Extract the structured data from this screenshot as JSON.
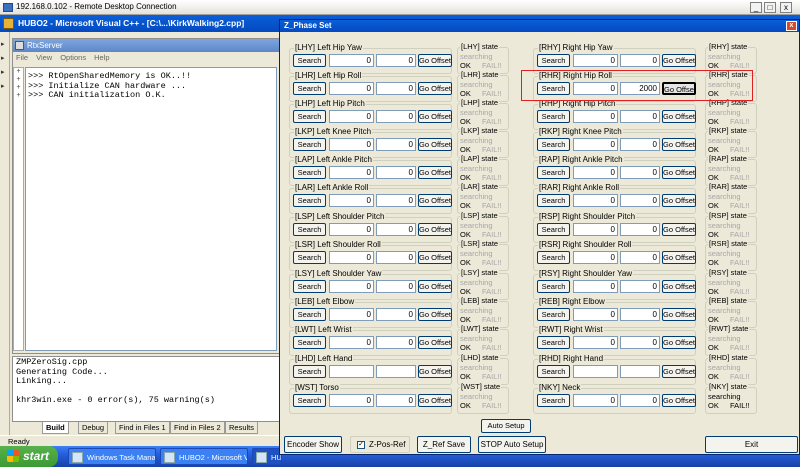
{
  "rdc": {
    "title": "192.168.0.102 - Remote Desktop Connection",
    "min": "_",
    "max": "□",
    "close": "x"
  },
  "vc": {
    "title": "HUBO2 - Microsoft Visual C++ - [C:\\...\\KirkWalking2.cpp]"
  },
  "rtx": {
    "title": "RtxServer",
    "menu": [
      "File",
      "View",
      "Options",
      "Help"
    ],
    "console": ">>> RtOpenSharedMemory is OK..!!\n>>> Initialize CAN hardware ...\n>>> CAN initialization O.K."
  },
  "output": {
    "text": "ZMPZeroSig.cpp\nGenerating Code...\nLinking...\n\nkhr3win.exe - 0 error(s), 75 warning(s)",
    "tabs": [
      "Build",
      "Debug",
      "Find in Files 1",
      "Find in Files 2",
      "Results"
    ]
  },
  "status": "Ready",
  "taskbar": {
    "start": "start",
    "items": [
      "Windows Task Manager",
      "HUBO2 - Microsoft Vis...",
      "HU"
    ]
  },
  "dialog": {
    "title": "Z_Phase Set",
    "close": "x",
    "common": {
      "search": "Search",
      "go_offset": "Go Offset",
      "go_offset_active": "Go Offset",
      "searching": "searching",
      "ok": "OK",
      "fail": "FAIL!!",
      "state": "state"
    },
    "left_joints": [
      {
        "label": "[LHY] Left Hip Yaw",
        "v1": "0",
        "v2": "0",
        "state": "[LHY] state"
      },
      {
        "label": "[LHR] Left Hip Roll",
        "v1": "0",
        "v2": "0",
        "state": "[LHR] state"
      },
      {
        "label": "[LHP] Left Hip Pitch",
        "v1": "0",
        "v2": "0",
        "state": "[LHP] state"
      },
      {
        "label": "[LKP] Left Knee Pitch",
        "v1": "0",
        "v2": "0",
        "state": "[LKP] state"
      },
      {
        "label": "[LAP] Left Ankle Pitch",
        "v1": "0",
        "v2": "0",
        "state": "[LAP] state"
      },
      {
        "label": "[LAR] Left Ankle Roll",
        "v1": "0",
        "v2": "0",
        "state": "[LAR] state"
      },
      {
        "label": "[LSP] Left Shoulder Pitch",
        "v1": "0",
        "v2": "0",
        "state": "[LSP] state"
      },
      {
        "label": "[LSR] Left Shoulder Roll",
        "v1": "0",
        "v2": "0",
        "state": "[LSR] state"
      },
      {
        "label": "[LSY] Left Shoulder Yaw",
        "v1": "0",
        "v2": "0",
        "state": "[LSY] state"
      },
      {
        "label": "[LEB] Left Elbow",
        "v1": "0",
        "v2": "0",
        "state": "[LEB] state"
      },
      {
        "label": "[LWT] Left Wrist",
        "v1": "0",
        "v2": "0",
        "state": "[LWT] state"
      },
      {
        "label": "[LHD] Left Hand",
        "v1": "",
        "v2": "",
        "state": "[LHD] state"
      },
      {
        "label": "[WST] Torso",
        "v1": "0",
        "v2": "0",
        "state": "[WST] state"
      }
    ],
    "right_joints": [
      {
        "label": "[RHY] Right Hip Yaw",
        "v1": "0",
        "v2": "0",
        "state": "[RHY] state"
      },
      {
        "label": "[RHR] Right Hip Roll",
        "v1": "0",
        "v2": "2000",
        "state": "[RHR] state"
      },
      {
        "label": "[RHP] Right Hip Pitch",
        "v1": "0",
        "v2": "0",
        "state": "[RHP] state"
      },
      {
        "label": "[RKP] Right Knee Pitch",
        "v1": "0",
        "v2": "0",
        "state": "[RKP] state"
      },
      {
        "label": "[RAP] Right Ankle Pitch",
        "v1": "0",
        "v2": "0",
        "state": "[RAP] state"
      },
      {
        "label": "[RAR] Right Ankle Roll",
        "v1": "0",
        "v2": "0",
        "state": "[RAR] state"
      },
      {
        "label": "[RSP] Right Shoulder Pitch",
        "v1": "0",
        "v2": "0",
        "state": "[RSP] state"
      },
      {
        "label": "[RSR] Right Shoulder Roll",
        "v1": "0",
        "v2": "0",
        "state": "[RSR] state"
      },
      {
        "label": "[RSY] Right Shoulder Yaw",
        "v1": "0",
        "v2": "0",
        "state": "[RSY] state"
      },
      {
        "label": "[REB] Right Elbow",
        "v1": "0",
        "v2": "0",
        "state": "[REB] state"
      },
      {
        "label": "[RWT] Right Wrist",
        "v1": "0",
        "v2": "0",
        "state": "[RWT] state"
      },
      {
        "label": "[RHD] Right Hand",
        "v1": "",
        "v2": "",
        "state": "[RHD] state"
      },
      {
        "label": "[NKY] Neck",
        "v1": "0",
        "v2": "0",
        "state": "[NKY] state",
        "active": true
      }
    ],
    "buttons": {
      "auto_setup": "Auto Setup",
      "encoder_show": "Encoder Show",
      "zpos_ref": "Z-Pos-Ref",
      "zref_save": "Z_Ref Save",
      "stop_auto_setup": "STOP Auto Setup",
      "exit": "Exit"
    },
    "zpos_checked": true
  }
}
